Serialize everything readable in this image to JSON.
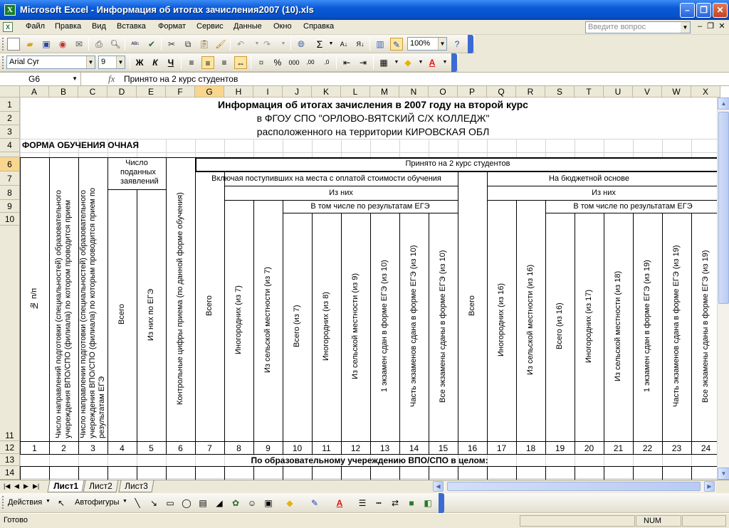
{
  "window": {
    "title": "Microsoft Excel - Информация об итогах зачисления2007 (10).xls"
  },
  "menu": [
    "Файл",
    "Правка",
    "Вид",
    "Вставка",
    "Формат",
    "Сервис",
    "Данные",
    "Окно",
    "Справка"
  ],
  "help_placeholder": "Введите вопрос",
  "toolbar": {
    "zoom": "100%",
    "font": "Arial Cyr",
    "size": "9"
  },
  "formula_bar": {
    "name_box": "G6",
    "fx": "fx",
    "value": "Принято на 2 курс студентов"
  },
  "columns": [
    "A",
    "B",
    "C",
    "D",
    "E",
    "F",
    "G",
    "H",
    "I",
    "J",
    "K",
    "L",
    "M",
    "N",
    "O",
    "P",
    "Q",
    "R",
    "S",
    "T",
    "U",
    "V",
    "W",
    "X"
  ],
  "rows": [
    "1",
    "2",
    "3",
    "4",
    "6",
    "7",
    "8",
    "9",
    "10",
    "11",
    "12",
    "13",
    "14"
  ],
  "sheet": {
    "title": "Информация об итогах зачисления в 2007 году на второй курс",
    "line2": "в ФГОУ СПО \"ОРЛОВО-ВЯТСКИЙ С/Х КОЛЛЕДЖ\"",
    "line3": "расположенного на территории КИРОВСКАЯ ОБЛ",
    "form": "ФОРМА ОБУЧЕНИЯ ОЧНАЯ",
    "h_accepted": "Принято на 2 курс студентов",
    "h_paid": "Включая поступивших на места с оплатой стоимости обучения",
    "h_budget": "На бюджетной основе",
    "h_of_them": "Из них",
    "h_ege": "В том числе по результатам ЕГЭ",
    "h_applications": "Число поданных заявлений",
    "vert": {
      "A": "№ п/п",
      "B": "Число направлений подготовки (специальностей) образовательного учереждения ВПО/СПО (филиала) по котором проводится прием",
      "C": "Число направлении подготовки (специальностей) образовательного учереждения ВПО/СПО (филиала) по которым проводится прием по результатам ЕГЭ",
      "D": "Всего",
      "E": "Из них по ЕГЭ",
      "F": "Контрольные цифры приема (по данной форме обучения)",
      "G": "Всего",
      "H": "Иногородних (из 7)",
      "I": "Из сельской местности (из 7)",
      "J": "Всего (из 7)",
      "K": "Иногородних (из 8)",
      "L": "Из сельской местности (из 9)",
      "M": "1 экзамен сдан в форме ЕГЭ (из 10)",
      "N": "Часть экзаменов сдана в форме ЕГЭ (из 10)",
      "O": "Все экзамены сданы в форме ЕГЭ (из 10)",
      "P": "Всего",
      "Q": "Иногородних (из 16)",
      "R": "Из сельской местности (из 16)",
      "S": "Всего (из 16)",
      "T": "Иногородних (из 17)",
      "U": "Из сельской местности (из 18)",
      "V": "1 экзамен сдан в форме ЕГЭ (из 19)",
      "W": "Часть экзаменов сдана в форме ЕГЭ (из 19)",
      "X": "Все экзамены сданы в форме ЕГЭ (из 19)"
    },
    "numbers": [
      "1",
      "2",
      "3",
      "4",
      "5",
      "6",
      "7",
      "8",
      "9",
      "10",
      "11",
      "12",
      "13",
      "14",
      "15",
      "16",
      "17",
      "18",
      "19",
      "20",
      "21",
      "22",
      "23",
      "24"
    ],
    "row13": "По образовательному учереждению ВПО/СПО в целом:"
  },
  "tabs": [
    "Лист1",
    "Лист2",
    "Лист3"
  ],
  "drawing": {
    "actions": "Действия",
    "autoshapes": "Автофигуры"
  },
  "status": {
    "ready": "Готово",
    "num": "NUM"
  }
}
